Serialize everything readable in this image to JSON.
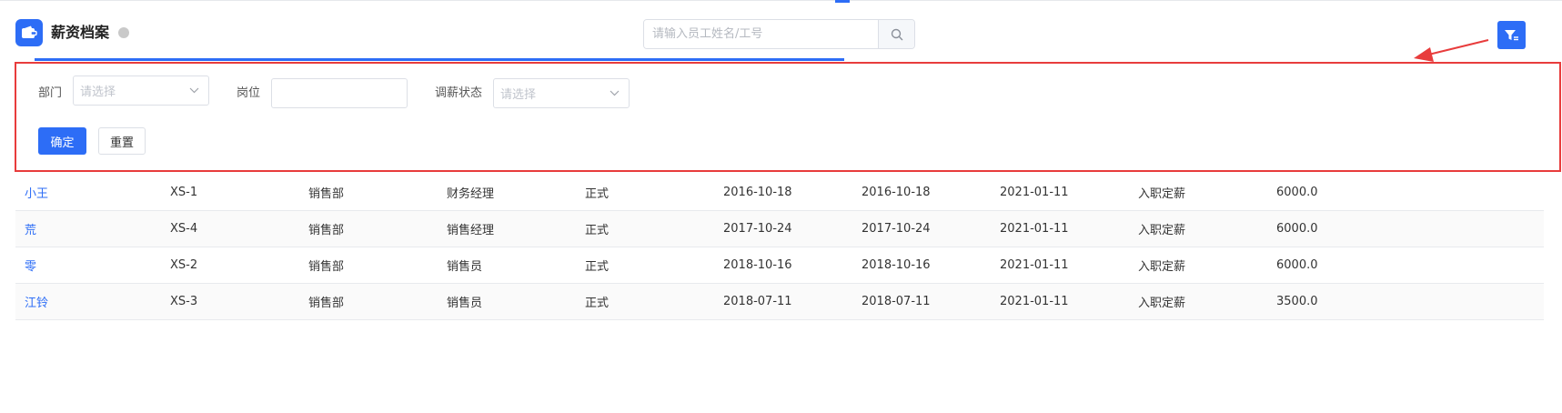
{
  "colors": {
    "accent": "#2d6df6",
    "annotation": "#e83c3c",
    "status_dot": "#c9c9c9"
  },
  "header": {
    "title": "薪资档案",
    "app_icon": "wallet-icon",
    "search": {
      "placeholder": "请输入员工姓名/工号",
      "icon": "search-icon"
    },
    "filter_icon": "filter-icon"
  },
  "filters": {
    "department": {
      "label": "部门",
      "placeholder": "请选择"
    },
    "position": {
      "label": "岗位",
      "value": ""
    },
    "adjust_status": {
      "label": "调薪状态",
      "placeholder": "请选择"
    },
    "confirm_label": "确定",
    "reset_label": "重置"
  },
  "table": {
    "rows": [
      [
        "小王",
        "XS-1",
        "销售部",
        "财务经理",
        "正式",
        "2016-10-18",
        "2016-10-18",
        "2021-01-11",
        "入职定薪",
        "6000.0"
      ],
      [
        "荒",
        "XS-4",
        "销售部",
        "销售经理",
        "正式",
        "2017-10-24",
        "2017-10-24",
        "2021-01-11",
        "入职定薪",
        "6000.0"
      ],
      [
        "零",
        "XS-2",
        "销售部",
        "销售员",
        "正式",
        "2018-10-16",
        "2018-10-16",
        "2021-01-11",
        "入职定薪",
        "6000.0"
      ],
      [
        "江铃",
        "XS-3",
        "销售部",
        "销售员",
        "正式",
        "2018-07-11",
        "2018-07-11",
        "2021-01-11",
        "入职定薪",
        "3500.0"
      ]
    ]
  }
}
